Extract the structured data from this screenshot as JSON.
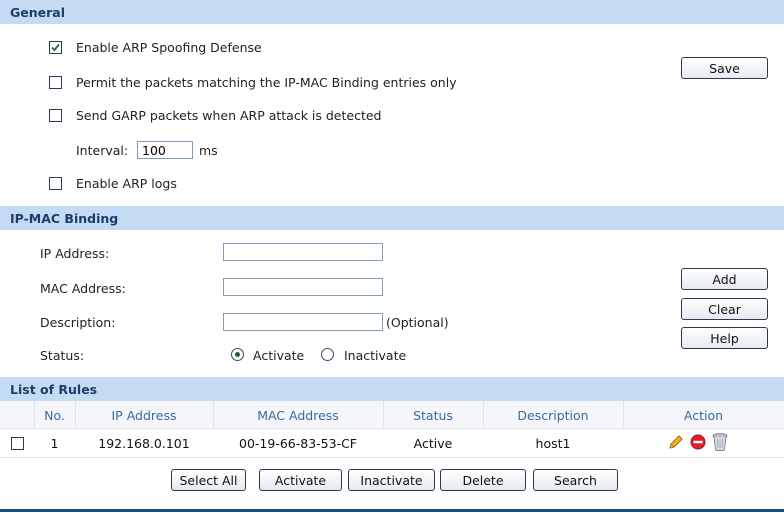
{
  "general": {
    "header": "General",
    "enable_arp_spoofing": {
      "label": "Enable ARP Spoofing Defense",
      "checked": true
    },
    "permit_ip_mac_only": {
      "label": "Permit the packets matching the IP-MAC Binding entries only",
      "checked": false
    },
    "send_garp": {
      "label": "Send GARP packets when ARP attack is detected",
      "checked": false
    },
    "interval": {
      "label": "Interval:",
      "value": "100",
      "unit": "ms"
    },
    "enable_arp_logs": {
      "label": "Enable ARP logs",
      "checked": false
    },
    "save_label": "Save"
  },
  "binding": {
    "header": "IP-MAC Binding",
    "ip_label": "IP Address:",
    "ip_value": "",
    "mac_label": "MAC Address:",
    "mac_value": "",
    "desc_label": "Description:",
    "desc_value": "",
    "desc_hint": "(Optional)",
    "status_label": "Status:",
    "status_options": [
      "Activate",
      "Inactivate"
    ],
    "status_selected": "Activate",
    "add_label": "Add",
    "clear_label": "Clear",
    "help_label": "Help"
  },
  "rules": {
    "header": "List of Rules",
    "columns": [
      "No.",
      "IP Address",
      "MAC Address",
      "Status",
      "Description",
      "Action"
    ],
    "rows": [
      {
        "no": "1",
        "ip": "192.168.0.101",
        "mac": "00-19-66-83-53-CF",
        "status": "Active",
        "description": "host1",
        "checked": false
      }
    ],
    "action_icons": [
      "edit-pencil-icon",
      "deactivate-icon",
      "delete-trash-icon"
    ],
    "buttons": {
      "select_all": "Select All",
      "activate": "Activate",
      "inactivate": "Inactivate",
      "delete": "Delete",
      "search": "Search"
    }
  },
  "colors": {
    "section_header_bg": "#c4dbf3",
    "section_header_text": "#1c3e69",
    "column_header_text": "#3a6aa0",
    "bottom_rule": "#1d4e7a"
  }
}
